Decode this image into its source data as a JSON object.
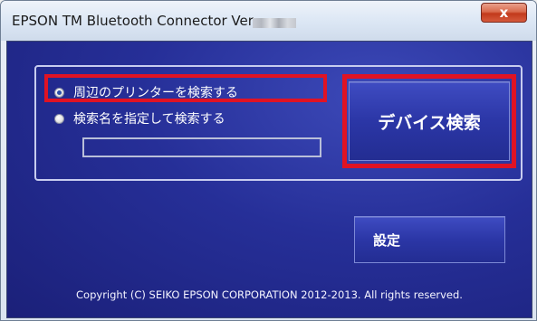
{
  "window": {
    "title": "EPSON TM Bluetooth Connector Ver.",
    "close_label": "x"
  },
  "search": {
    "option_nearby_label": "周辺のプリンターを検索する",
    "option_nearby_selected": true,
    "option_by_name_label": "検索名を指定して検索する",
    "option_by_name_selected": false,
    "search_name_value": ""
  },
  "buttons": {
    "device_search_label": "デバイス検索",
    "settings_label": "設定"
  },
  "footer": {
    "copyright": "Copyright (C) SEIKO EPSON CORPORATION 2012-2013. All rights reserved."
  },
  "colors": {
    "highlight_outline": "#e01324",
    "client_background": "#262f98",
    "button_background": "#2b36a6"
  }
}
